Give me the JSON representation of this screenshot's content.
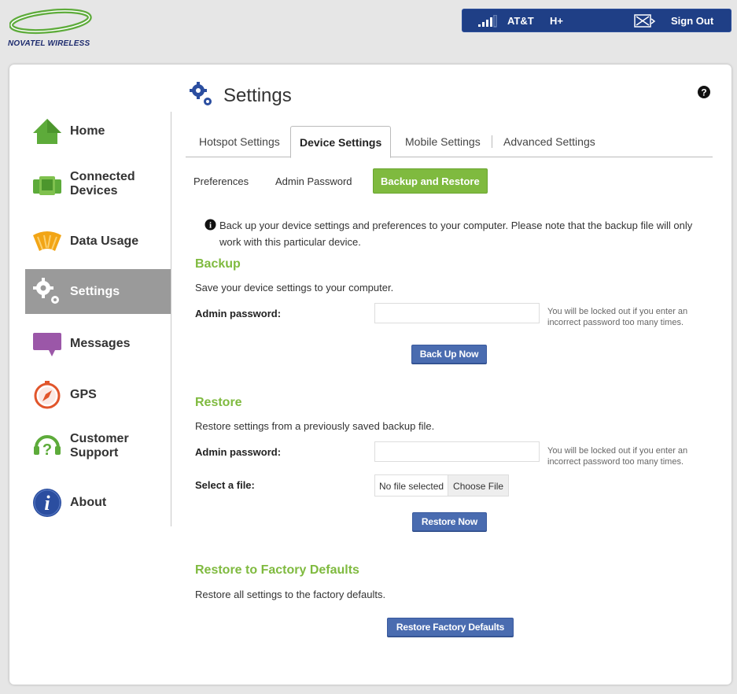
{
  "header": {
    "brand": "NOVATEL WIRELESS",
    "carrier": "AT&T",
    "network": "H+",
    "sign_out": "Sign Out",
    "colors": {
      "status_bar": "#1f3f86",
      "logo_green": "#5dab3a"
    }
  },
  "sidebar": {
    "items": [
      {
        "label": "Home",
        "icon": "home-icon"
      },
      {
        "label": "Connected\nDevices",
        "icon": "connected-devices-icon"
      },
      {
        "label": "Data Usage",
        "icon": "data-usage-icon"
      },
      {
        "label": "Settings",
        "icon": "gear-icon",
        "active": true
      },
      {
        "label": "Messages",
        "icon": "message-bubble-icon"
      },
      {
        "label": "GPS",
        "icon": "compass-icon"
      },
      {
        "label": "Customer\nSupport",
        "icon": "support-icon"
      },
      {
        "label": "About",
        "icon": "info-circle-icon"
      }
    ]
  },
  "page": {
    "title": "Settings",
    "tabs": [
      "Hotspot Settings",
      "Device Settings",
      "Mobile Settings",
      "Advanced Settings"
    ],
    "active_tab": "Device Settings",
    "subtabs": [
      "Preferences",
      "Admin Password",
      "Backup and Restore"
    ],
    "active_subtab": "Backup and Restore",
    "info": "Back up your device settings and preferences to your computer. Please note that the backup file will only work with this particular device.",
    "accent_color": "#7fba3f",
    "button_color": "#4a6cb0"
  },
  "backup": {
    "title": "Backup",
    "description": "Save your device settings to your computer.",
    "password_label": "Admin password:",
    "password_value": "",
    "hint": "You will be locked out if you enter an incorrect password too many times.",
    "button": "Back Up Now"
  },
  "restore": {
    "title": "Restore",
    "description": "Restore settings from a previously saved backup file.",
    "password_label": "Admin password:",
    "password_value": "",
    "hint": "You will be locked out if you enter an incorrect password too many times.",
    "file_label": "Select a file:",
    "file_status": "No file selected",
    "choose_file": "Choose File",
    "button": "Restore Now"
  },
  "factory": {
    "title": "Restore to Factory Defaults",
    "description": "Restore all settings to the factory defaults.",
    "button": "Restore Factory Defaults"
  }
}
